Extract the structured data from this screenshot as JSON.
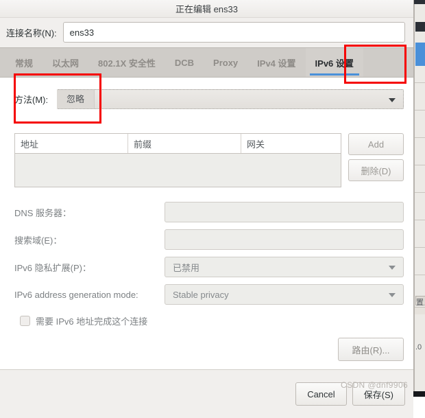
{
  "window": {
    "title": "正在编辑 ens33"
  },
  "connection": {
    "label": "连接名称(N):",
    "value": "ens33",
    "placeholder": ""
  },
  "tabs": [
    {
      "label": "常规",
      "active": false
    },
    {
      "label": "以太网",
      "active": false
    },
    {
      "label": "802.1X 安全性",
      "active": false
    },
    {
      "label": "DCB",
      "active": false
    },
    {
      "label": "Proxy",
      "active": false
    },
    {
      "label": "IPv4 设置",
      "active": false
    },
    {
      "label": "IPv6 设置",
      "active": true
    }
  ],
  "method": {
    "label": "方法(M):",
    "value": "忽略",
    "arrow_icon": "chevron-down-icon"
  },
  "address_table": {
    "columns": [
      "地址",
      "前缀",
      "网关"
    ],
    "rows": [],
    "add_label": "Add",
    "delete_label": "删除(D)"
  },
  "form": {
    "dns_label": "DNS 服务器：",
    "dns_value": "",
    "search_label": "搜索域(E)：",
    "search_value": "",
    "privacy_label": "IPv6 隐私扩展(P)：",
    "privacy_value": "已禁用",
    "genmode_label": "IPv6 address generation mode:",
    "genmode_value": "Stable privacy"
  },
  "require_checkbox": {
    "label": "需要 IPv6 地址完成这个连接",
    "checked": false
  },
  "routes_button": {
    "label": "路由(R)..."
  },
  "actions": {
    "cancel_label": "Cancel",
    "save_label": "保存(S)"
  },
  "watermark": {
    "text": "CSDN @dnf9906"
  },
  "background": {
    "fragment_right": "置",
    "fragment_right2": ".0"
  },
  "colors": {
    "accent": "#4a90d9",
    "annotation": "#f50000",
    "dialog_bg": "#f1efed",
    "page_bg": "#ffffff",
    "tabbar_bg": "#cfccc8"
  }
}
